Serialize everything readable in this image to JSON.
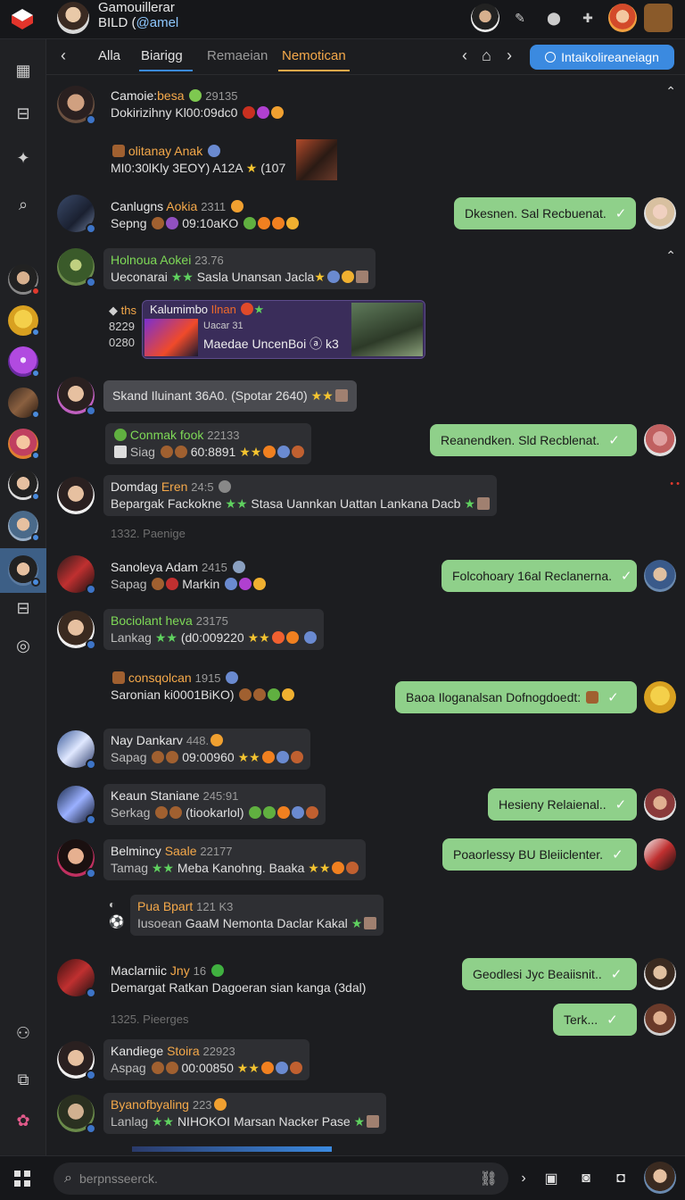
{
  "app": {
    "title": "Gamouillerar",
    "subtitle": "BILD (",
    "subtitle_tag": "@amel"
  },
  "tabs": [
    {
      "label": "Alla"
    },
    {
      "label": "Biarigg"
    },
    {
      "label": "Remaeian"
    },
    {
      "label": "Nemotican"
    }
  ],
  "header": {
    "cta_label": "Intaikolireaneiagn"
  },
  "messages": [
    {
      "name": "Camoie:",
      "name_hl": "besa",
      "time": "29135",
      "text": "Dokirizihny Kl00:09dc0"
    },
    {
      "name": "olitanay",
      "name_hl": "Anak",
      "time": "",
      "text": "MI0:30lKly 3EOY) A12A",
      "tail": "(107"
    },
    {
      "name": "Canlugns",
      "name_hl": "Aokia",
      "time": "2311",
      "text": "Sepng",
      "text2": "09:10aKO"
    },
    {
      "name": "Holnoua",
      "name_hl": "Aokei",
      "time": "23.76",
      "text": "Ueconarai",
      "text2": "Sasla Unansan Jacla"
    },
    {
      "name": "Skand Iluinant 36A0. (Spotar 2640)"
    },
    {
      "name": "Conmak",
      "name_hl": "fook",
      "time": "22133",
      "text": "Siag",
      "text2": "60:8891"
    },
    {
      "name": "Domdag",
      "name_hl": "Eren",
      "time": "24:5",
      "text": "Bepargak Fackokne",
      "text2": "Stasa Uannkan Uattan Lankana Dacb"
    },
    {
      "name": "Sanoleya Adam",
      "time": "2415",
      "text": "Sapag",
      "text2": "Markin"
    },
    {
      "name": "Bociolant",
      "name_hl": "heva",
      "time": "23175",
      "text": "Lankag",
      "text2": "(d0:009220"
    },
    {
      "name": "consqolcan",
      "time": "1915",
      "text": "Saronian ki0001BiKO)"
    },
    {
      "name": "Nay Dankarv",
      "time": "448.",
      "text": "Sapag",
      "text2": "09:00960"
    },
    {
      "name": "Keaun Staniane",
      "time": "245:91",
      "text": "Serkag",
      "text2": "(tiookarlol)"
    },
    {
      "name": "Belmincy",
      "name_hl": "Saale",
      "time": "22177",
      "text": "Tamag",
      "text2": "Meba Kanohng. Baaka"
    },
    {
      "name": "Pua",
      "name_hl": "Bpart",
      "time": "121 K3",
      "text": "Iusoean",
      "text2": "GaaM Nemonta Daclar Kakal"
    },
    {
      "name": "Maclarniic",
      "name_hl": "Jny",
      "time": "16",
      "text": "Demargat Ratkan Dagoeran sian kanga (3dal)"
    },
    {
      "name": "Kandiege",
      "name_hl": "Stoira",
      "time": "22923",
      "text": "Aspag",
      "text2": "00:00850"
    },
    {
      "name": "Byanofbyaling",
      "time": "223",
      "text": "Lanlag",
      "text2": "NIHOKOI Marsan Nacker Pase"
    }
  ],
  "card": {
    "title": "Kalumimbo",
    "title_hl": "Ilnan",
    "sub": "Uacar 31",
    "text": "Maedae UncenBoi",
    "tail": "k3",
    "side1": "ths",
    "side2": "8229",
    "side3": "0280"
  },
  "replies": [
    {
      "text": "Dkesnen. Sal Recbuenat."
    },
    {
      "text": "Reanendken. Sld Recblenat."
    },
    {
      "text": "Folcohoary 16al Reclanerna."
    },
    {
      "text": "Baoa Iloganalsan Dofnogdoedt:"
    },
    {
      "text": "Hesieny Relaienal.."
    },
    {
      "text": "Poaorlessy BU Bleiiclenter."
    },
    {
      "text": "Geodlesi Jyc Beaiisnit.."
    },
    {
      "text": "Terk..."
    }
  ],
  "dividers": [
    "1332. Paenige",
    "1325. Pieerges"
  ],
  "composer": {
    "placeholder": "berpnsseerck."
  },
  "colors": {
    "accent": "#3b8ae0",
    "reply": "#8fd08a",
    "highlight": "#f5a94a",
    "green": "#7ed957"
  }
}
